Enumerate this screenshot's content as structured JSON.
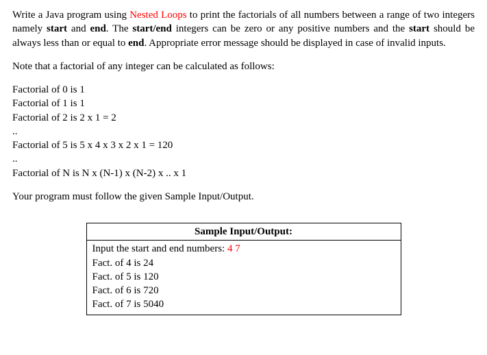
{
  "para1": {
    "t1": "Write a Java program using ",
    "nested": "Nested Loops",
    "t2": " to print the factorials of all numbers between a range of two integers namely ",
    "start1": "start",
    "t3": " and ",
    "end1": "end",
    "t4": ". The ",
    "startend": "start/end",
    "t5": " integers can be zero or any positive numbers and the ",
    "start2": "start",
    "t6": " should be always less than or equal to ",
    "end2": "end",
    "t7": ". Appropriate error message should be displayed in case of invalid inputs."
  },
  "note": "Note that a factorial of any integer can be calculated as follows:",
  "facts": {
    "f0": "Factorial of 0 is 1",
    "f1": "Factorial of 1 is 1",
    "f2": "Factorial of 2 is 2 x 1 = 2",
    "dots1": "..",
    "f5": "Factorial of 5 is 5 x 4 x 3 x 2 x 1 = 120",
    "dots2": "..",
    "fn": "Factorial of N is N x (N-1) x (N-2) x .. x 1"
  },
  "follow": "Your program must follow the given Sample Input/Output.",
  "sample": {
    "header": "Sample Input/Output:",
    "prompt": "Input the start and end numbers: ",
    "input": "4  7",
    "r1": "Fact. of 4 is 24",
    "r2": "Fact. of 5 is 120",
    "r3": "Fact. of 6 is 720",
    "r4": "Fact. of 7 is 5040"
  }
}
